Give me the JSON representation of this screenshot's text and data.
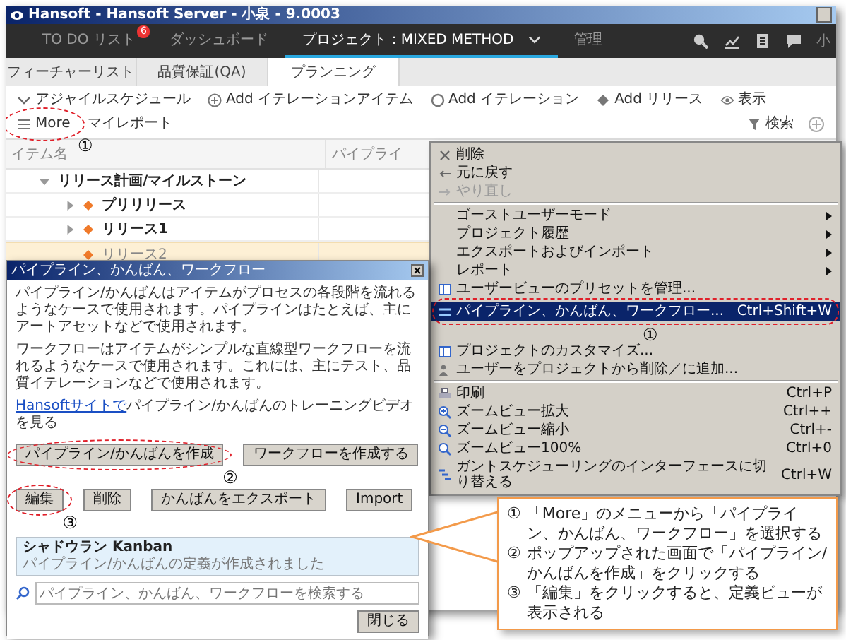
{
  "window": {
    "title": "Hansoft - Hansoft Server - 小泉 - 9.0003"
  },
  "nav": {
    "items": [
      {
        "label": "TO DO リスト",
        "badge": "6",
        "selected": false,
        "dropdown": false
      },
      {
        "label": "ダッシュボード",
        "selected": false,
        "dropdown": false
      },
      {
        "label": "プロジェクト：MIXED METHOD",
        "selected": true,
        "dropdown": true
      },
      {
        "label": "管理",
        "selected": false,
        "dropdown": false
      }
    ],
    "user": "小"
  },
  "tabs": [
    {
      "label": "フィーチャーリスト",
      "selected": false
    },
    {
      "label": "品質保証(QA)",
      "selected": false
    },
    {
      "label": "プランニング",
      "selected": true
    }
  ],
  "toolbar": {
    "items": [
      {
        "kind": "dropdown",
        "label": "アジャイルスケジュール"
      },
      {
        "kind": "add",
        "label": "Add イテレーションアイテム"
      },
      {
        "kind": "iteration",
        "label": "Add イテレーション"
      },
      {
        "kind": "release",
        "label": "Add リリース"
      },
      {
        "kind": "view",
        "label": "表示"
      },
      {
        "kind": "menu",
        "label": "More",
        "annotation": "①"
      },
      {
        "kind": "plain",
        "label": "マイレポート"
      }
    ],
    "search": "検索"
  },
  "table": {
    "columns": [
      "イテム名",
      "パイプライ"
    ],
    "rows": [
      {
        "name": "リリース計画/マイルストーン",
        "expanded": true,
        "selected": false,
        "children": [
          {
            "name": "プリリリース",
            "expanded": false,
            "selected": false
          },
          {
            "name": "リリース1",
            "expanded": false,
            "selected": false
          },
          {
            "name": "リリース2",
            "selected": true
          }
        ]
      }
    ]
  },
  "menu": {
    "items": [
      {
        "kind": "command",
        "label": "削除",
        "disabled": false,
        "selected": false
      },
      {
        "kind": "command",
        "label": "元に戻す",
        "disabled": false,
        "selected": false
      },
      {
        "kind": "command",
        "label": "やり直し",
        "disabled": true,
        "selected": false
      },
      {
        "kind": "separator"
      },
      {
        "kind": "submenu",
        "label": "ゴーストユーザーモード",
        "disabled": false,
        "selected": false
      },
      {
        "kind": "submenu",
        "label": "プロジェクト履歴",
        "disabled": false,
        "selected": false
      },
      {
        "kind": "submenu",
        "label": "エクスポートおよびインポート",
        "disabled": false,
        "selected": false
      },
      {
        "kind": "submenu",
        "label": "レポート",
        "disabled": false,
        "selected": false
      },
      {
        "kind": "command",
        "label": "ユーザービューのプリセットを管理...",
        "disabled": false,
        "selected": false
      },
      {
        "kind": "command",
        "label": "パイプライン、かんばん、ワークフロー...",
        "shortcut": "Ctrl+Shift+W",
        "disabled": false,
        "selected": true,
        "annotation": "①"
      },
      {
        "kind": "command",
        "label": "プロジェクトのカスタマイズ...",
        "disabled": false,
        "selected": false
      },
      {
        "kind": "command",
        "label": "ユーザーをプロジェクトから削除／に追加...",
        "disabled": false,
        "selected": false
      },
      {
        "kind": "separator"
      },
      {
        "kind": "command",
        "label": "印刷",
        "shortcut": "Ctrl+P",
        "disabled": false,
        "selected": false
      },
      {
        "kind": "command",
        "label": "ズームビュー拡大",
        "shortcut": "Ctrl++",
        "disabled": false,
        "selected": false
      },
      {
        "kind": "command",
        "label": "ズームビュー縮小",
        "shortcut": "Ctrl+-",
        "disabled": false,
        "selected": false
      },
      {
        "kind": "command",
        "label": "ズームビュー100%",
        "shortcut": "Ctrl+0",
        "disabled": false,
        "selected": false
      },
      {
        "kind": "command",
        "label": "ガントスケジューリングのインターフェースに切り替える",
        "shortcut": "Ctrl+W",
        "disabled": false,
        "selected": false
      }
    ]
  },
  "dialog": {
    "title": "パイプライン、かんばん、ワークフロー",
    "paragraphs": [
      "パイプライン/かんばんはアイテムがプロセスの各段階を流れるようなケースで使用されます。パイプラインはたとえば、主にアートアセットなどで使用されます。",
      "ワークフローはアイテムがシンプルな直線型ワークフローを流れるようなケースで使用されます。これには、主にテスト、品質イテレーションなどで使用されます。"
    ],
    "link": "Hansoftサイトで",
    "link_rest": "パイプライン/かんばんのトレーニングビデオを見る",
    "buttons": [
      {
        "label": "パイプライン/かんばんを作成",
        "annotation": "②"
      },
      {
        "label": "ワークフローを作成する"
      },
      {
        "label": "編集",
        "annotation": "③"
      },
      {
        "label": "削除"
      },
      {
        "label": "かんばんをエクスポート"
      },
      {
        "label": "Import"
      }
    ],
    "list": [
      {
        "name": "シャドウラン Kanban",
        "detail": "パイプライン/かんばんの定義が作成されました",
        "selected": true
      }
    ],
    "search_placeholder": "パイプライン、かんばん、ワークフローを検索する",
    "close_button": "閉じる"
  },
  "callout": {
    "steps": [
      {
        "number": "①",
        "text": "「More」のメニューから「パイプライン、かんばん、ワークフロー」を選択する"
      },
      {
        "number": "②",
        "text": "ポップアップされた画面で「パイプライン/かんばんを作成」をクリックする"
      },
      {
        "number": "③",
        "text": "「編集」をクリックすると、定義ビューが表示される"
      }
    ]
  }
}
